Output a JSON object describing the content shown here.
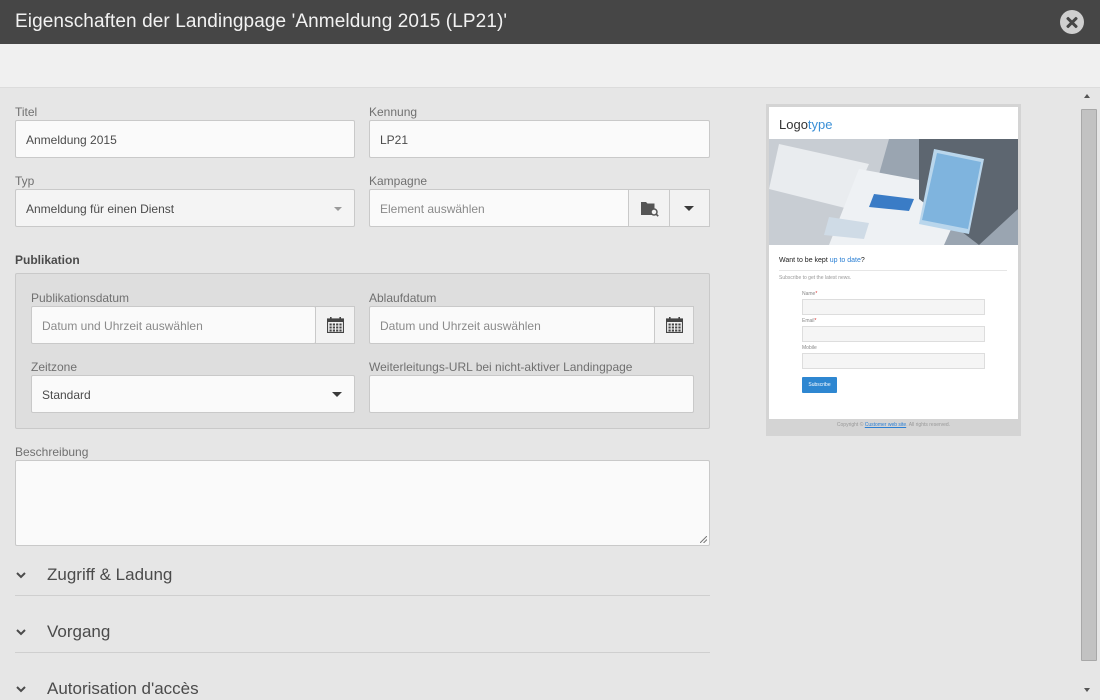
{
  "dialog": {
    "title": "Eigenschaften der Landingpage 'Anmeldung 2015 (LP21)'"
  },
  "form": {
    "titel": {
      "label": "Titel",
      "value": "Anmeldung 2015"
    },
    "kennung": {
      "label": "Kennung",
      "value": "LP21"
    },
    "typ": {
      "label": "Typ",
      "value": "Anmeldung für einen Dienst"
    },
    "kampagne": {
      "label": "Kampagne",
      "placeholder": "Element auswählen"
    },
    "publikation": {
      "heading": "Publikation",
      "publikationsdatum": {
        "label": "Publikationsdatum",
        "placeholder": "Datum und Uhrzeit auswählen"
      },
      "ablaufdatum": {
        "label": "Ablaufdatum",
        "placeholder": "Datum und Uhrzeit auswählen"
      },
      "zeitzone": {
        "label": "Zeitzone",
        "value": "Standard"
      },
      "weiterleitung": {
        "label": "Weiterleitungs-URL bei nicht-aktiver Landingpage",
        "value": ""
      }
    },
    "beschreibung": {
      "label": "Beschreibung",
      "value": ""
    }
  },
  "accordions": [
    {
      "label": "Zugriff & Ladung"
    },
    {
      "label": "Vorgang"
    },
    {
      "label": "Autorisation d'accès"
    }
  ],
  "preview": {
    "logo_a": "Logo",
    "logo_b": "type",
    "headline_a": "Want to be kept ",
    "headline_link": "up to date",
    "headline_b": "?",
    "subtitle": "Subscribe to get the latest news.",
    "fields": [
      {
        "label": "Name",
        "required": "*"
      },
      {
        "label": "Email",
        "required": "*"
      },
      {
        "label": "Mobile",
        "required": ""
      }
    ],
    "button": "Subscribe",
    "footer_a": "Copyright © ",
    "footer_link": "Customer web site",
    "footer_b": ". All rights reserved."
  },
  "colors": {
    "titlebar": "#464646",
    "accent": "#2e87d1"
  }
}
